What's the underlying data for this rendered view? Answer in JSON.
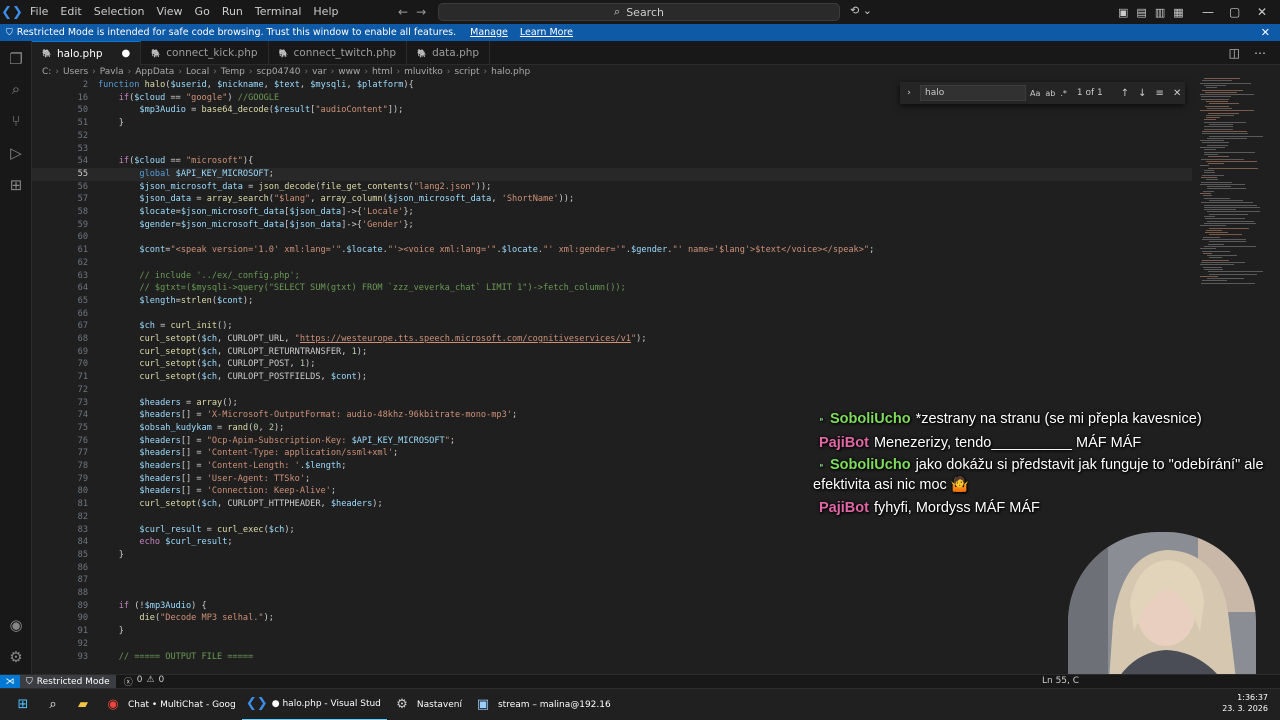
{
  "titlebar": {
    "menu": [
      "File",
      "Edit",
      "Selection",
      "View",
      "Go",
      "Run",
      "Terminal",
      "Help"
    ],
    "search_placeholder": "Search",
    "nav_back": "←",
    "nav_forward": "→"
  },
  "banner": {
    "text": "Restricted Mode is intended for safe code browsing. Trust this window to enable all features.",
    "manage": "Manage",
    "learn_more": "Learn More"
  },
  "tabs": [
    {
      "label": "halo.php",
      "modified": "●"
    },
    {
      "label": "connect_kick.php"
    },
    {
      "label": "connect_twitch.php"
    },
    {
      "label": "data.php"
    }
  ],
  "breadcrumb": [
    "C:",
    "Users",
    "Pavla",
    "AppData",
    "Local",
    "Temp",
    "scp04740",
    "var",
    "www",
    "html",
    "mluvitko",
    "script",
    "halo.php"
  ],
  "find": {
    "query": "halo",
    "count": "1 of 1",
    "match_case": "Aa",
    "whole_word": "ab",
    "regex": ".*"
  },
  "code_lines": [
    {
      "n": "2",
      "html": "<span class='kw2'>function</span> <span class='fn'>halo</span>(<span class='var'>$userid</span>, <span class='var'>$nickname</span>, <span class='var'>$text</span>, <span class='var'>$mysqli</span>, <span class='var'>$platform</span>){"
    },
    {
      "n": "16",
      "html": "    <span class='kw'>if</span>(<span class='var'>$cloud</span> == <span class='str'>\"google\"</span>) <span class='cm'>//GOOGLE</span>"
    },
    {
      "n": "50",
      "html": "        <span class='var'>$mp3Audio</span> = <span class='fn'>base64_decode</span>(<span class='var'>$result</span>[<span class='str'>\"audioContent\"</span>]);"
    },
    {
      "n": "51",
      "html": "    }"
    },
    {
      "n": "52",
      "html": ""
    },
    {
      "n": "53",
      "html": ""
    },
    {
      "n": "54",
      "html": "    <span class='kw'>if</span>(<span class='var'>$cloud</span> == <span class='str'>\"microsoft\"</span>){"
    },
    {
      "n": "55",
      "html": "        <span class='kw2'>global</span> <span class='var'>$API_KEY_MICROSOFT</span>;",
      "cur": true
    },
    {
      "n": "56",
      "html": "        <span class='var'>$json_microsoft_data</span> = <span class='fn'>json_decode</span>(<span class='fn'>file_get_contents</span>(<span class='str'>\"lang2.json\"</span>));"
    },
    {
      "n": "57",
      "html": "        <span class='var'>$json_data</span> = <span class='fn'>array_search</span>(<span class='str'>\"$lang\"</span>, <span class='fn'>array_column</span>(<span class='var'>$json_microsoft_data</span>, <span class='str'>'ShortName'</span>));"
    },
    {
      "n": "58",
      "html": "        <span class='var'>$locate</span>=<span class='var'>$json_microsoft_data</span>[<span class='var'>$json_data</span>]-&gt;{<span class='str'>'Locale'</span>};"
    },
    {
      "n": "59",
      "html": "        <span class='var'>$gender</span>=<span class='var'>$json_microsoft_data</span>[<span class='var'>$json_data</span>]-&gt;{<span class='str'>'Gender'</span>};"
    },
    {
      "n": "60",
      "html": ""
    },
    {
      "n": "61",
      "html": "        <span class='var'>$cont</span>=<span class='str'>\"&lt;speak version='1.0' xml:lang='\"</span>.<span class='var'>$locate</span>.<span class='str'>\"'&gt;&lt;voice xml:lang='\"</span>.<span class='var'>$locate</span>.<span class='str'>\"' xml:gender='\"</span>.<span class='var'>$gender</span>.<span class='str'>\"' name='$lang'&gt;$text&lt;/voice&gt;&lt;/speak&gt;\"</span>;"
    },
    {
      "n": "62",
      "html": ""
    },
    {
      "n": "63",
      "html": "        <span class='cm'>// include '../ex/_config.php';</span>"
    },
    {
      "n": "64",
      "html": "        <span class='cm'>// $gtxt=($mysqli->query(\"SELECT SUM(gtxt) FROM `zzz_veverka_chat` LIMIT 1\")->fetch_column());</span>"
    },
    {
      "n": "65",
      "html": "        <span class='var'>$length</span>=<span class='fn'>strlen</span>(<span class='var'>$cont</span>);"
    },
    {
      "n": "66",
      "html": ""
    },
    {
      "n": "67",
      "html": "        <span class='var'>$ch</span> = <span class='fn'>curl_init</span>();"
    },
    {
      "n": "68",
      "html": "        <span class='fn'>curl_setopt</span>(<span class='var'>$ch</span>, CURLOPT_URL, <span class='str'>\"<u>https://westeurope.tts.speech.microsoft.com/cognitiveservices/v1</u>\"</span>);"
    },
    {
      "n": "69",
      "html": "        <span class='fn'>curl_setopt</span>(<span class='var'>$ch</span>, CURLOPT_RETURNTRANSFER, <span class='num'>1</span>);"
    },
    {
      "n": "70",
      "html": "        <span class='fn'>curl_setopt</span>(<span class='var'>$ch</span>, CURLOPT_POST, <span class='num'>1</span>);"
    },
    {
      "n": "71",
      "html": "        <span class='fn'>curl_setopt</span>(<span class='var'>$ch</span>, CURLOPT_POSTFIELDS, <span class='var'>$cont</span>);"
    },
    {
      "n": "72",
      "html": ""
    },
    {
      "n": "73",
      "html": "        <span class='var'>$headers</span> = <span class='fn'>array</span>();"
    },
    {
      "n": "74",
      "html": "        <span class='var'>$headers</span>[] = <span class='str'>'X-Microsoft-OutputFormat: audio-48khz-96kbitrate-mono-mp3'</span>;"
    },
    {
      "n": "75",
      "html": "        <span class='var'>$obsah_kudykam</span> = <span class='fn'>rand</span>(<span class='num'>0</span>, <span class='num'>2</span>);"
    },
    {
      "n": "76",
      "html": "        <span class='var'>$headers</span>[] = <span class='str'>\"Ocp-Apim-Subscription-Key: </span><span class='var'>$API_KEY_MICROSOFT</span><span class='str'>\"</span>;"
    },
    {
      "n": "77",
      "html": "        <span class='var'>$headers</span>[] = <span class='str'>'Content-Type: application/ssml+xml'</span>;"
    },
    {
      "n": "78",
      "html": "        <span class='var'>$headers</span>[] = <span class='str'>'Content-Length: '</span>.<span class='var'>$length</span>;"
    },
    {
      "n": "79",
      "html": "        <span class='var'>$headers</span>[] = <span class='str'>'User-Agent: TTSko'</span>;"
    },
    {
      "n": "80",
      "html": "        <span class='var'>$headers</span>[] = <span class='str'>'Connection: Keep-Alive'</span>;"
    },
    {
      "n": "81",
      "html": "        <span class='fn'>curl_setopt</span>(<span class='var'>$ch</span>, CURLOPT_HTTPHEADER, <span class='var'>$headers</span>);"
    },
    {
      "n": "82",
      "html": ""
    },
    {
      "n": "83",
      "html": "        <span class='var'>$curl_result</span> = <span class='fn'>curl_exec</span>(<span class='var'>$ch</span>);"
    },
    {
      "n": "84",
      "html": "        <span class='kw'>echo</span> <span class='var'>$curl_result</span>;"
    },
    {
      "n": "85",
      "html": "    }"
    },
    {
      "n": "86",
      "html": ""
    },
    {
      "n": "87",
      "html": ""
    },
    {
      "n": "88",
      "html": ""
    },
    {
      "n": "89",
      "html": "    <span class='kw'>if</span> (!<span class='var'>$mp3Audio</span>) {"
    },
    {
      "n": "90",
      "html": "        <span class='fn'>die</span>(<span class='str'>\"Decode MP3 selhal.\"</span>);"
    },
    {
      "n": "91",
      "html": "    }"
    },
    {
      "n": "92",
      "html": ""
    },
    {
      "n": "93",
      "html": "    <span class='cm'>// ===== OUTPUT FILE =====</span>"
    }
  ],
  "chat": [
    {
      "nick": "SoboliUcho",
      "nick_color": "#7fdc5a",
      "badge": "⁍",
      "text": "*zestrany na stranu (se mi přepla kavesnice)"
    },
    {
      "nick": "PajiBot",
      "nick_color": "#e066a6",
      "text": "Menezerizy, tendo__________ MÁF MÁF"
    },
    {
      "nick": "SoboliUcho",
      "nick_color": "#7fdc5a",
      "badge": "⁍",
      "text": "jako dokážu si představit jak funguje to \"odebírání\" ale efektivita asi nic moc 🤷"
    },
    {
      "nick": "PajiBot",
      "nick_color": "#e066a6",
      "text": "fyhyfi, Mordyss MÁF MÁF"
    }
  ],
  "status": {
    "restricted": "Restricted Mode",
    "errors": "0",
    "warnings": "0",
    "position": "Ln 55, C"
  },
  "taskbar": [
    {
      "label": "",
      "icon": "windows-start-icon"
    },
    {
      "label": "",
      "icon": "search-icon"
    },
    {
      "label": "",
      "icon": "file-explorer-icon"
    },
    {
      "label": "Chat • MultiChat - Goog",
      "icon": "chrome-icon"
    },
    {
      "label": "● halo.php - Visual Stud",
      "icon": "vscode-icon",
      "active": true
    },
    {
      "label": "Nastavení",
      "icon": "settings-icon"
    },
    {
      "label": "stream – malina@192.16",
      "icon": "remote-icon"
    }
  ],
  "clock": {
    "time": "1:36:37",
    "date": "23. 3. 2026"
  }
}
